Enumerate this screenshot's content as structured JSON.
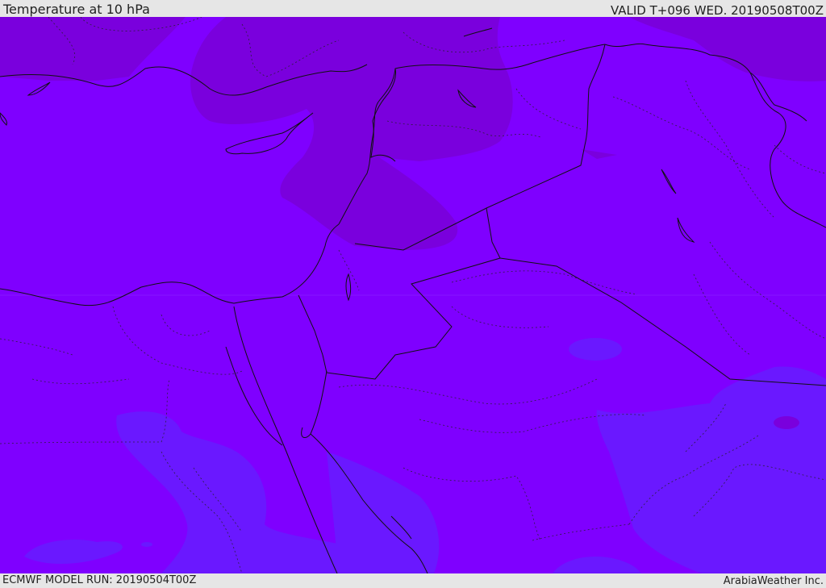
{
  "header": {
    "title": "Temperature at 10 hPa",
    "valid": "VALID T+096 WED. 20190508T00Z"
  },
  "footer": {
    "model_run": "ECMWF MODEL RUN: 20190504T00Z",
    "credit": "ArabiaWeather Inc."
  },
  "colors": {
    "base_field": "#7f00ff",
    "warm_patch": "#7a00dd",
    "cool_patch": "#6a18ff",
    "border_line": "#111111"
  }
}
